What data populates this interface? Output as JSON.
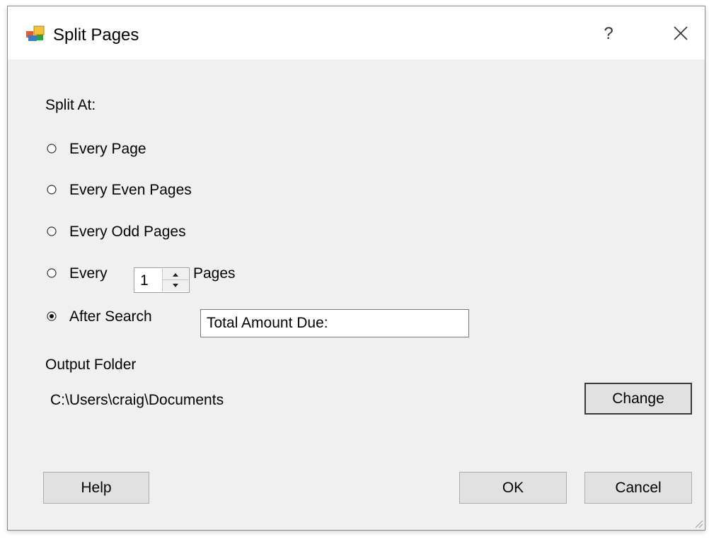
{
  "window": {
    "title": "Split Pages",
    "help_glyph": "?",
    "icons": {
      "app": "app-icon",
      "close": "close-icon",
      "grip": "resize-grip-icon"
    }
  },
  "split_section": {
    "heading": "Split At:",
    "options": [
      {
        "label": "Every Page",
        "selected": false
      },
      {
        "label": "Every Even Pages",
        "selected": false
      },
      {
        "label": "Every Odd Pages",
        "selected": false
      },
      {
        "label": "Every",
        "suffix": "Pages",
        "selected": false
      },
      {
        "label": "After Search",
        "selected": true
      }
    ],
    "every_n_value": "1",
    "search_value": "Total Amount Due:"
  },
  "output": {
    "heading": "Output Folder",
    "path": "C:\\Users\\craig\\Documents",
    "change_label": "Change"
  },
  "buttons": {
    "help": "Help",
    "ok": "OK",
    "cancel": "Cancel"
  }
}
